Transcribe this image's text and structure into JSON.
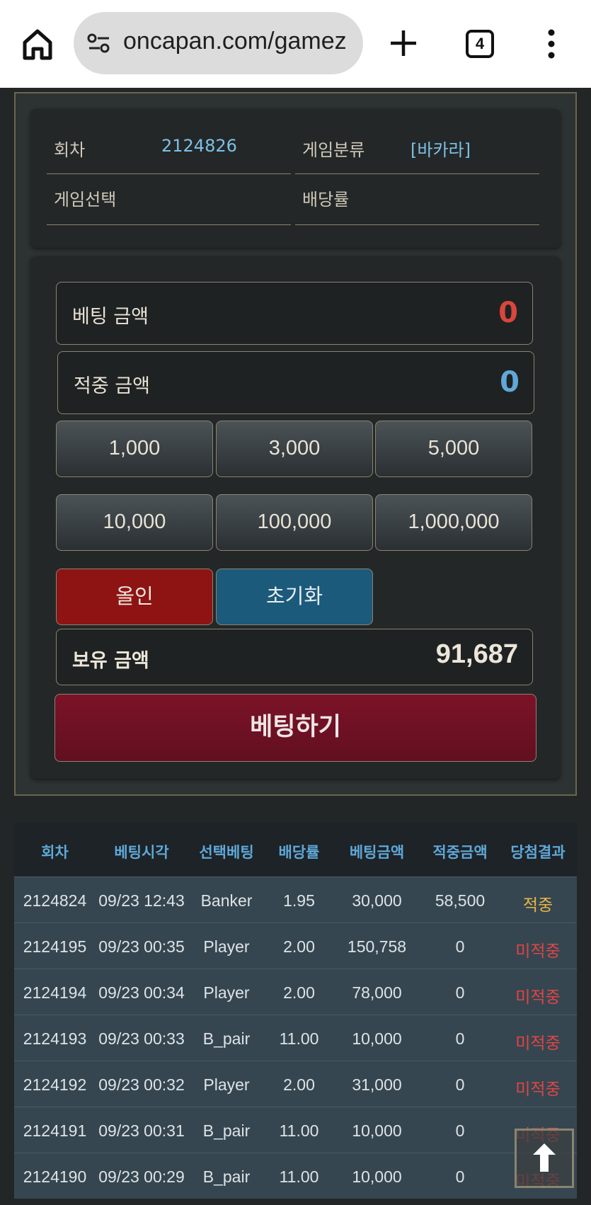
{
  "browser": {
    "url": "oncapan.com/gamez",
    "tab_count": "4"
  },
  "info": {
    "round_label": "회차",
    "round_value": "2124826",
    "category_label": "게임분류",
    "category_value": "[바카라]",
    "selection_label": "게임선택",
    "odds_label": "배당률"
  },
  "bet": {
    "bet_amount_label": "베팅 금액",
    "bet_amount_value": "0",
    "win_amount_label": "적중 금액",
    "win_amount_value": "0",
    "chips": [
      "1,000",
      "3,000",
      "5,000",
      "10,000",
      "100,000",
      "1,000,000"
    ],
    "allin_label": "올인",
    "reset_label": "초기화",
    "balance_label": "보유 금액",
    "balance_value": "91,687",
    "submit_label": "베팅하기"
  },
  "history": {
    "headers": [
      "회차",
      "베팅시각",
      "선택베팅",
      "배당률",
      "베팅금액",
      "적중금액",
      "당첨결과"
    ],
    "rows": [
      [
        "2124824",
        "09/23 12:43",
        "Banker",
        "1.95",
        "30,000",
        "58,500",
        "적중"
      ],
      [
        "2124195",
        "09/23 00:35",
        "Player",
        "2.00",
        "150,758",
        "0",
        "미적중"
      ],
      [
        "2124194",
        "09/23 00:34",
        "Player",
        "2.00",
        "78,000",
        "0",
        "미적중"
      ],
      [
        "2124193",
        "09/23 00:33",
        "B_pair",
        "11.00",
        "10,000",
        "0",
        "미적중"
      ],
      [
        "2124192",
        "09/23 00:32",
        "Player",
        "2.00",
        "31,000",
        "0",
        "미적중"
      ],
      [
        "2124191",
        "09/23 00:31",
        "B_pair",
        "11.00",
        "10,000",
        "0",
        "미적중"
      ],
      [
        "2124190",
        "09/23 00:29",
        "B_pair",
        "11.00",
        "10,000",
        "0",
        "미적중"
      ]
    ]
  },
  "colors": {
    "bet_amount": "#d9463c",
    "win_amount": "#5fa8d8",
    "hit": "#e8b548",
    "miss": "#e04545"
  },
  "icons": {
    "home": "home-icon",
    "site_settings": "tune-icon",
    "new_tab": "plus-icon",
    "menu": "more-vert-icon",
    "to_top": "arrow-up-icon"
  }
}
